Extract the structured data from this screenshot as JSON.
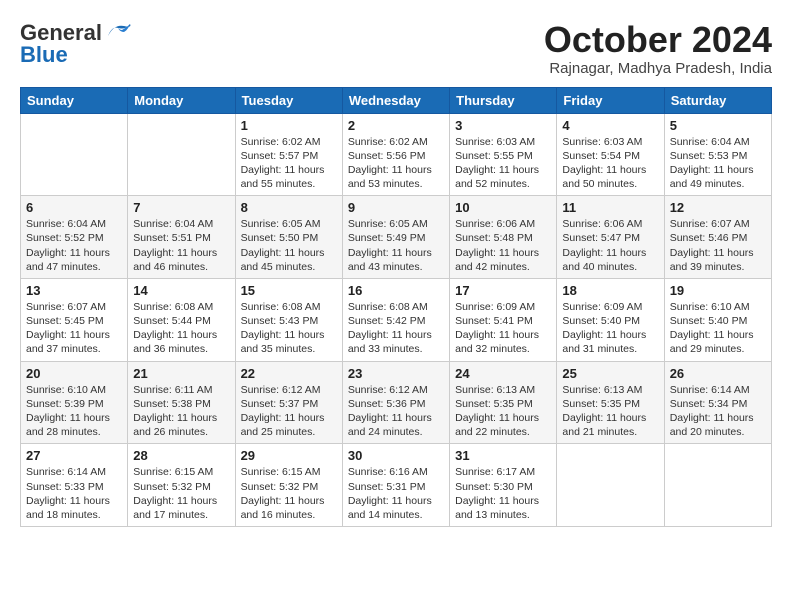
{
  "header": {
    "logo_general": "General",
    "logo_blue": "Blue",
    "month_title": "October 2024",
    "location": "Rajnagar, Madhya Pradesh, India"
  },
  "weekdays": [
    "Sunday",
    "Monday",
    "Tuesday",
    "Wednesday",
    "Thursday",
    "Friday",
    "Saturday"
  ],
  "weeks": [
    [
      {
        "day": "",
        "info": ""
      },
      {
        "day": "",
        "info": ""
      },
      {
        "day": "1",
        "info": "Sunrise: 6:02 AM\nSunset: 5:57 PM\nDaylight: 11 hours and 55 minutes."
      },
      {
        "day": "2",
        "info": "Sunrise: 6:02 AM\nSunset: 5:56 PM\nDaylight: 11 hours and 53 minutes."
      },
      {
        "day": "3",
        "info": "Sunrise: 6:03 AM\nSunset: 5:55 PM\nDaylight: 11 hours and 52 minutes."
      },
      {
        "day": "4",
        "info": "Sunrise: 6:03 AM\nSunset: 5:54 PM\nDaylight: 11 hours and 50 minutes."
      },
      {
        "day": "5",
        "info": "Sunrise: 6:04 AM\nSunset: 5:53 PM\nDaylight: 11 hours and 49 minutes."
      }
    ],
    [
      {
        "day": "6",
        "info": "Sunrise: 6:04 AM\nSunset: 5:52 PM\nDaylight: 11 hours and 47 minutes."
      },
      {
        "day": "7",
        "info": "Sunrise: 6:04 AM\nSunset: 5:51 PM\nDaylight: 11 hours and 46 minutes."
      },
      {
        "day": "8",
        "info": "Sunrise: 6:05 AM\nSunset: 5:50 PM\nDaylight: 11 hours and 45 minutes."
      },
      {
        "day": "9",
        "info": "Sunrise: 6:05 AM\nSunset: 5:49 PM\nDaylight: 11 hours and 43 minutes."
      },
      {
        "day": "10",
        "info": "Sunrise: 6:06 AM\nSunset: 5:48 PM\nDaylight: 11 hours and 42 minutes."
      },
      {
        "day": "11",
        "info": "Sunrise: 6:06 AM\nSunset: 5:47 PM\nDaylight: 11 hours and 40 minutes."
      },
      {
        "day": "12",
        "info": "Sunrise: 6:07 AM\nSunset: 5:46 PM\nDaylight: 11 hours and 39 minutes."
      }
    ],
    [
      {
        "day": "13",
        "info": "Sunrise: 6:07 AM\nSunset: 5:45 PM\nDaylight: 11 hours and 37 minutes."
      },
      {
        "day": "14",
        "info": "Sunrise: 6:08 AM\nSunset: 5:44 PM\nDaylight: 11 hours and 36 minutes."
      },
      {
        "day": "15",
        "info": "Sunrise: 6:08 AM\nSunset: 5:43 PM\nDaylight: 11 hours and 35 minutes."
      },
      {
        "day": "16",
        "info": "Sunrise: 6:08 AM\nSunset: 5:42 PM\nDaylight: 11 hours and 33 minutes."
      },
      {
        "day": "17",
        "info": "Sunrise: 6:09 AM\nSunset: 5:41 PM\nDaylight: 11 hours and 32 minutes."
      },
      {
        "day": "18",
        "info": "Sunrise: 6:09 AM\nSunset: 5:40 PM\nDaylight: 11 hours and 31 minutes."
      },
      {
        "day": "19",
        "info": "Sunrise: 6:10 AM\nSunset: 5:40 PM\nDaylight: 11 hours and 29 minutes."
      }
    ],
    [
      {
        "day": "20",
        "info": "Sunrise: 6:10 AM\nSunset: 5:39 PM\nDaylight: 11 hours and 28 minutes."
      },
      {
        "day": "21",
        "info": "Sunrise: 6:11 AM\nSunset: 5:38 PM\nDaylight: 11 hours and 26 minutes."
      },
      {
        "day": "22",
        "info": "Sunrise: 6:12 AM\nSunset: 5:37 PM\nDaylight: 11 hours and 25 minutes."
      },
      {
        "day": "23",
        "info": "Sunrise: 6:12 AM\nSunset: 5:36 PM\nDaylight: 11 hours and 24 minutes."
      },
      {
        "day": "24",
        "info": "Sunrise: 6:13 AM\nSunset: 5:35 PM\nDaylight: 11 hours and 22 minutes."
      },
      {
        "day": "25",
        "info": "Sunrise: 6:13 AM\nSunset: 5:35 PM\nDaylight: 11 hours and 21 minutes."
      },
      {
        "day": "26",
        "info": "Sunrise: 6:14 AM\nSunset: 5:34 PM\nDaylight: 11 hours and 20 minutes."
      }
    ],
    [
      {
        "day": "27",
        "info": "Sunrise: 6:14 AM\nSunset: 5:33 PM\nDaylight: 11 hours and 18 minutes."
      },
      {
        "day": "28",
        "info": "Sunrise: 6:15 AM\nSunset: 5:32 PM\nDaylight: 11 hours and 17 minutes."
      },
      {
        "day": "29",
        "info": "Sunrise: 6:15 AM\nSunset: 5:32 PM\nDaylight: 11 hours and 16 minutes."
      },
      {
        "day": "30",
        "info": "Sunrise: 6:16 AM\nSunset: 5:31 PM\nDaylight: 11 hours and 14 minutes."
      },
      {
        "day": "31",
        "info": "Sunrise: 6:17 AM\nSunset: 5:30 PM\nDaylight: 11 hours and 13 minutes."
      },
      {
        "day": "",
        "info": ""
      },
      {
        "day": "",
        "info": ""
      }
    ]
  ]
}
